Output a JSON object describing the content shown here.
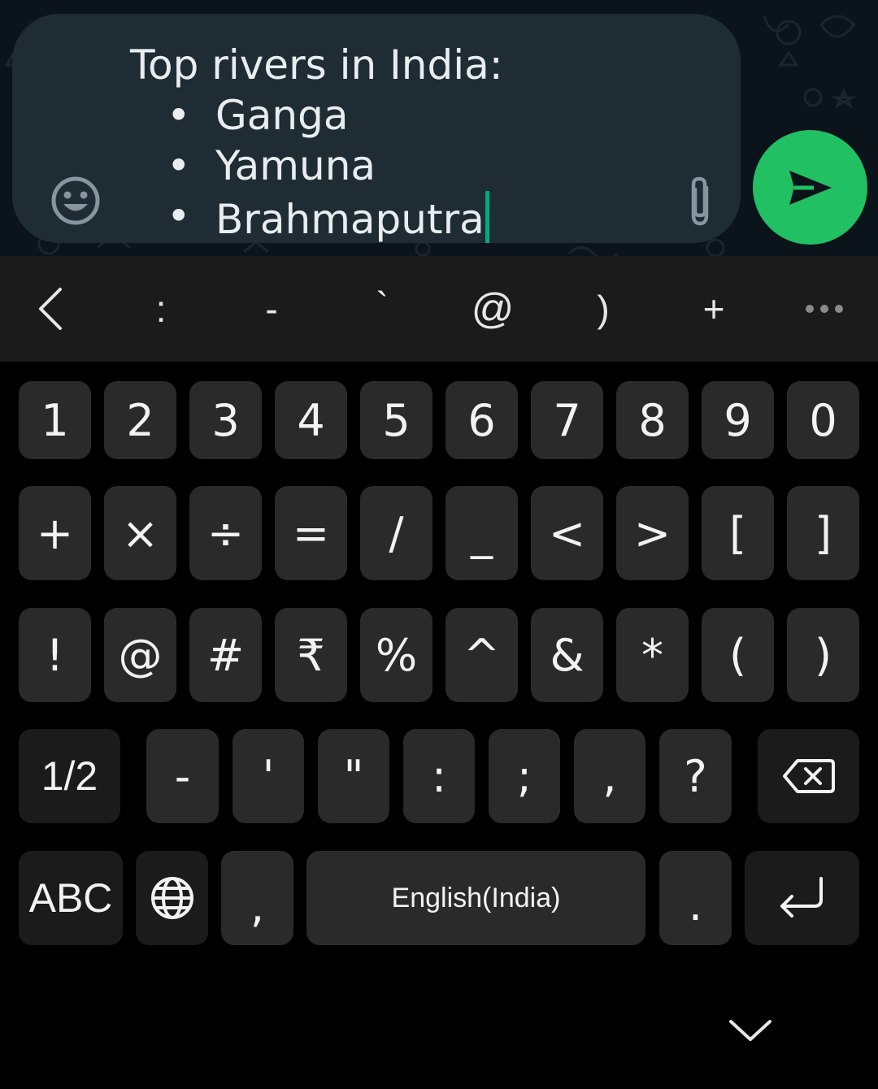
{
  "composer": {
    "title": "Top rivers in India:",
    "bullet": "•",
    "items": [
      "Ganga",
      "Yamuna",
      "Brahmaputra"
    ]
  },
  "suggestions": [
    ":",
    "-",
    "`",
    "@",
    ")",
    "+"
  ],
  "keys": {
    "row1": [
      "1",
      "2",
      "3",
      "4",
      "5",
      "6",
      "7",
      "8",
      "9",
      "0"
    ],
    "row2": [
      "+",
      "×",
      "÷",
      "=",
      "/",
      "_",
      "<",
      ">",
      "[",
      "]"
    ],
    "row3": [
      "!",
      "@",
      "#",
      "₹",
      "%",
      "^",
      "&",
      "*",
      "(",
      ")"
    ],
    "row4_page": "1/2",
    "row4": [
      "-",
      "'",
      "\"",
      ":",
      ";",
      ",",
      "?"
    ],
    "abc": "ABC",
    "comma": ",",
    "space": "English(India)",
    "period": "."
  },
  "colors": {
    "send": "#21c063",
    "caret": "#00a884",
    "composer_bg": "#1f2c34",
    "key_bg": "#2a2a2a"
  },
  "icons": {
    "emoji": "smiley-icon",
    "attach": "paperclip-icon",
    "send": "send-arrow-icon",
    "back": "chevron-left-icon",
    "more": "more-dots-icon",
    "backspace": "backspace-icon",
    "globe": "globe-icon",
    "enter": "enter-icon",
    "hide": "chevron-down-icon"
  }
}
